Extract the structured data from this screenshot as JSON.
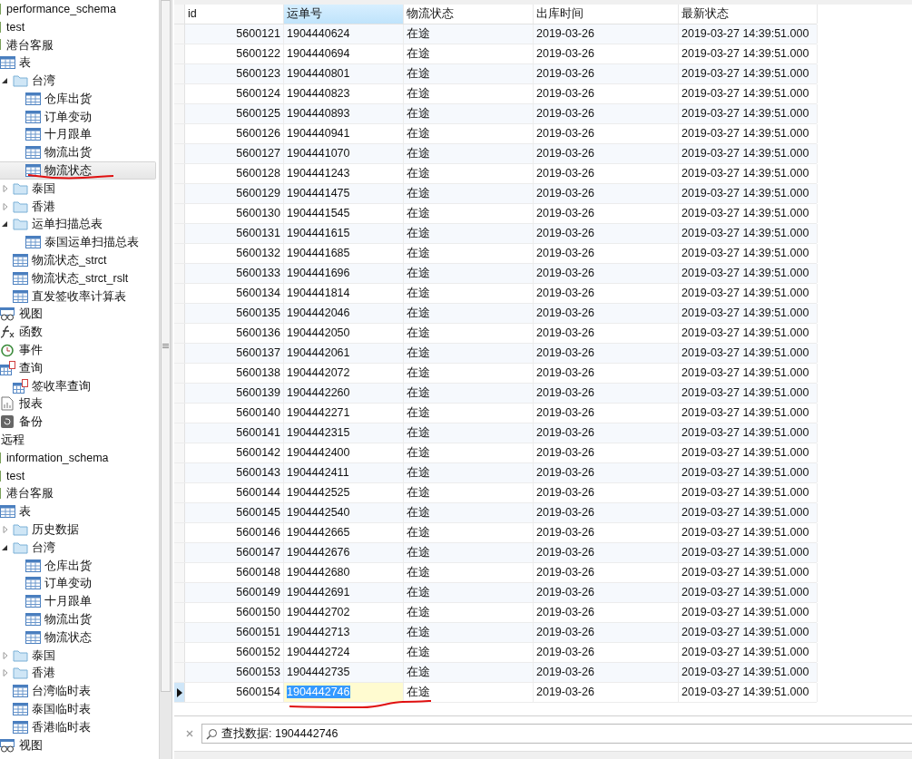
{
  "sidebar": {
    "tree": [
      {
        "children": [
          {
            "kind": "database",
            "label": "performance_schema",
            "selected": false
          },
          {
            "kind": "database",
            "label": "test",
            "selected": false
          },
          {
            "kind": "database",
            "label": "港台客服",
            "expanded": true,
            "selected": false,
            "children": [
              {
                "kind": "tables",
                "label": "表",
                "expanded": true,
                "selected": false,
                "children": [
                  {
                    "kind": "folder",
                    "label": "台湾",
                    "expanded": true,
                    "selected": false,
                    "children": [
                      {
                        "kind": "table",
                        "label": "仓库出货",
                        "selected": false
                      },
                      {
                        "kind": "table",
                        "label": "订单变动",
                        "selected": false
                      },
                      {
                        "kind": "table",
                        "label": "十月跟单",
                        "selected": false
                      },
                      {
                        "kind": "table",
                        "label": "物流出货",
                        "selected": false
                      },
                      {
                        "kind": "table",
                        "label": "物流状态",
                        "selected": true
                      }
                    ]
                  },
                  {
                    "kind": "folder",
                    "label": "泰国",
                    "expanded": false,
                    "selected": false
                  },
                  {
                    "kind": "folder",
                    "label": "香港",
                    "expanded": false,
                    "selected": false
                  },
                  {
                    "kind": "folder",
                    "label": "运单扫描总表",
                    "expanded": true,
                    "selected": false,
                    "children": [
                      {
                        "kind": "table",
                        "label": "泰国运单扫描总表",
                        "selected": false
                      }
                    ]
                  },
                  {
                    "kind": "table",
                    "label": "物流状态_strct",
                    "selected": false
                  },
                  {
                    "kind": "table",
                    "label": "物流状态_strct_rslt",
                    "selected": false
                  },
                  {
                    "kind": "table",
                    "label": "直发签收率计算表",
                    "selected": false
                  }
                ]
              },
              {
                "kind": "views",
                "label": "视图",
                "selected": false
              },
              {
                "kind": "functions",
                "label": "函数",
                "selected": false
              },
              {
                "kind": "events",
                "label": "事件",
                "selected": false
              },
              {
                "kind": "queries",
                "label": "查询",
                "expanded": true,
                "selected": false,
                "children": [
                  {
                    "kind": "query",
                    "label": "签收率查询",
                    "selected": false
                  }
                ]
              },
              {
                "kind": "reports",
                "label": "报表",
                "selected": false
              },
              {
                "kind": "backups",
                "label": "备份",
                "selected": false
              }
            ]
          }
        ]
      },
      {
        "label": "远程",
        "selected": false,
        "children": [
          {
            "kind": "database",
            "label": "information_schema",
            "selected": false
          },
          {
            "kind": "database",
            "label": "test",
            "selected": false
          },
          {
            "kind": "database",
            "label": "港台客服",
            "expanded": true,
            "selected": false,
            "children": [
              {
                "kind": "tables",
                "label": "表",
                "expanded": true,
                "selected": false,
                "children": [
                  {
                    "kind": "folder",
                    "label": "历史数据",
                    "expanded": false,
                    "selected": false
                  },
                  {
                    "kind": "folder",
                    "label": "台湾",
                    "expanded": true,
                    "selected": false,
                    "children": [
                      {
                        "kind": "table",
                        "label": "仓库出货",
                        "selected": false
                      },
                      {
                        "kind": "table",
                        "label": "订单变动",
                        "selected": false
                      },
                      {
                        "kind": "table",
                        "label": "十月跟单",
                        "selected": false
                      },
                      {
                        "kind": "table",
                        "label": "物流出货",
                        "selected": false
                      },
                      {
                        "kind": "table",
                        "label": "物流状态",
                        "selected": false
                      }
                    ]
                  },
                  {
                    "kind": "folder",
                    "label": "泰国",
                    "expanded": false,
                    "selected": false
                  },
                  {
                    "kind": "folder",
                    "label": "香港",
                    "expanded": false,
                    "selected": false
                  },
                  {
                    "kind": "table",
                    "label": "台湾临时表",
                    "selected": false
                  },
                  {
                    "kind": "table",
                    "label": "泰国临时表",
                    "selected": false
                  },
                  {
                    "kind": "table",
                    "label": "香港临时表",
                    "selected": false
                  }
                ]
              },
              {
                "kind": "views",
                "label": "视图",
                "selected": false
              }
            ]
          }
        ]
      }
    ]
  },
  "table": {
    "columns": [
      {
        "label": "id",
        "selected": false
      },
      {
        "label": "运单号",
        "selected": true
      },
      {
        "label": "物流状态",
        "selected": false
      },
      {
        "label": "出库时间",
        "selected": false
      },
      {
        "label": "最新状态",
        "selected": false
      }
    ],
    "rows": [
      {
        "cells": [
          "5600121",
          "1904440624",
          "在途",
          "2019-03-26",
          "2019-03-27 14:39:51.000"
        ],
        "selected": false
      },
      {
        "cells": [
          "5600122",
          "1904440694",
          "在途",
          "2019-03-26",
          "2019-03-27 14:39:51.000"
        ],
        "selected": false
      },
      {
        "cells": [
          "5600123",
          "1904440801",
          "在途",
          "2019-03-26",
          "2019-03-27 14:39:51.000"
        ],
        "selected": false
      },
      {
        "cells": [
          "5600124",
          "1904440823",
          "在途",
          "2019-03-26",
          "2019-03-27 14:39:51.000"
        ],
        "selected": false
      },
      {
        "cells": [
          "5600125",
          "1904440893",
          "在途",
          "2019-03-26",
          "2019-03-27 14:39:51.000"
        ],
        "selected": false
      },
      {
        "cells": [
          "5600126",
          "1904440941",
          "在途",
          "2019-03-26",
          "2019-03-27 14:39:51.000"
        ],
        "selected": false
      },
      {
        "cells": [
          "5600127",
          "1904441070",
          "在途",
          "2019-03-26",
          "2019-03-27 14:39:51.000"
        ],
        "selected": false
      },
      {
        "cells": [
          "5600128",
          "1904441243",
          "在途",
          "2019-03-26",
          "2019-03-27 14:39:51.000"
        ],
        "selected": false
      },
      {
        "cells": [
          "5600129",
          "1904441475",
          "在途",
          "2019-03-26",
          "2019-03-27 14:39:51.000"
        ],
        "selected": false
      },
      {
        "cells": [
          "5600130",
          "1904441545",
          "在途",
          "2019-03-26",
          "2019-03-27 14:39:51.000"
        ],
        "selected": false
      },
      {
        "cells": [
          "5600131",
          "1904441615",
          "在途",
          "2019-03-26",
          "2019-03-27 14:39:51.000"
        ],
        "selected": false
      },
      {
        "cells": [
          "5600132",
          "1904441685",
          "在途",
          "2019-03-26",
          "2019-03-27 14:39:51.000"
        ],
        "selected": false
      },
      {
        "cells": [
          "5600133",
          "1904441696",
          "在途",
          "2019-03-26",
          "2019-03-27 14:39:51.000"
        ],
        "selected": false
      },
      {
        "cells": [
          "5600134",
          "1904441814",
          "在途",
          "2019-03-26",
          "2019-03-27 14:39:51.000"
        ],
        "selected": false
      },
      {
        "cells": [
          "5600135",
          "1904442046",
          "在途",
          "2019-03-26",
          "2019-03-27 14:39:51.000"
        ],
        "selected": false
      },
      {
        "cells": [
          "5600136",
          "1904442050",
          "在途",
          "2019-03-26",
          "2019-03-27 14:39:51.000"
        ],
        "selected": false
      },
      {
        "cells": [
          "5600137",
          "1904442061",
          "在途",
          "2019-03-26",
          "2019-03-27 14:39:51.000"
        ],
        "selected": false
      },
      {
        "cells": [
          "5600138",
          "1904442072",
          "在途",
          "2019-03-26",
          "2019-03-27 14:39:51.000"
        ],
        "selected": false
      },
      {
        "cells": [
          "5600139",
          "1904442260",
          "在途",
          "2019-03-26",
          "2019-03-27 14:39:51.000"
        ],
        "selected": false
      },
      {
        "cells": [
          "5600140",
          "1904442271",
          "在途",
          "2019-03-26",
          "2019-03-27 14:39:51.000"
        ],
        "selected": false
      },
      {
        "cells": [
          "5600141",
          "1904442315",
          "在途",
          "2019-03-26",
          "2019-03-27 14:39:51.000"
        ],
        "selected": false
      },
      {
        "cells": [
          "5600142",
          "1904442400",
          "在途",
          "2019-03-26",
          "2019-03-27 14:39:51.000"
        ],
        "selected": false
      },
      {
        "cells": [
          "5600143",
          "1904442411",
          "在途",
          "2019-03-26",
          "2019-03-27 14:39:51.000"
        ],
        "selected": false
      },
      {
        "cells": [
          "5600144",
          "1904442525",
          "在途",
          "2019-03-26",
          "2019-03-27 14:39:51.000"
        ],
        "selected": false
      },
      {
        "cells": [
          "5600145",
          "1904442540",
          "在途",
          "2019-03-26",
          "2019-03-27 14:39:51.000"
        ],
        "selected": false
      },
      {
        "cells": [
          "5600146",
          "1904442665",
          "在途",
          "2019-03-26",
          "2019-03-27 14:39:51.000"
        ],
        "selected": false
      },
      {
        "cells": [
          "5600147",
          "1904442676",
          "在途",
          "2019-03-26",
          "2019-03-27 14:39:51.000"
        ],
        "selected": false
      },
      {
        "cells": [
          "5600148",
          "1904442680",
          "在途",
          "2019-03-26",
          "2019-03-27 14:39:51.000"
        ],
        "selected": false
      },
      {
        "cells": [
          "5600149",
          "1904442691",
          "在途",
          "2019-03-26",
          "2019-03-27 14:39:51.000"
        ],
        "selected": false
      },
      {
        "cells": [
          "5600150",
          "1904442702",
          "在途",
          "2019-03-26",
          "2019-03-27 14:39:51.000"
        ],
        "selected": false
      },
      {
        "cells": [
          "5600151",
          "1904442713",
          "在途",
          "2019-03-26",
          "2019-03-27 14:39:51.000"
        ],
        "selected": false
      },
      {
        "cells": [
          "5600152",
          "1904442724",
          "在途",
          "2019-03-26",
          "2019-03-27 14:39:51.000"
        ],
        "selected": false
      },
      {
        "cells": [
          "5600153",
          "1904442735",
          "在途",
          "2019-03-26",
          "2019-03-27 14:39:51.000"
        ],
        "selected": false
      },
      {
        "cells": [
          "5600154",
          "1904442746",
          "在途",
          "2019-03-26",
          "2019-03-27 14:39:51.000"
        ],
        "selected": true
      }
    ]
  },
  "find_bar": {
    "label": "查找数据:",
    "value": "1904442746"
  }
}
